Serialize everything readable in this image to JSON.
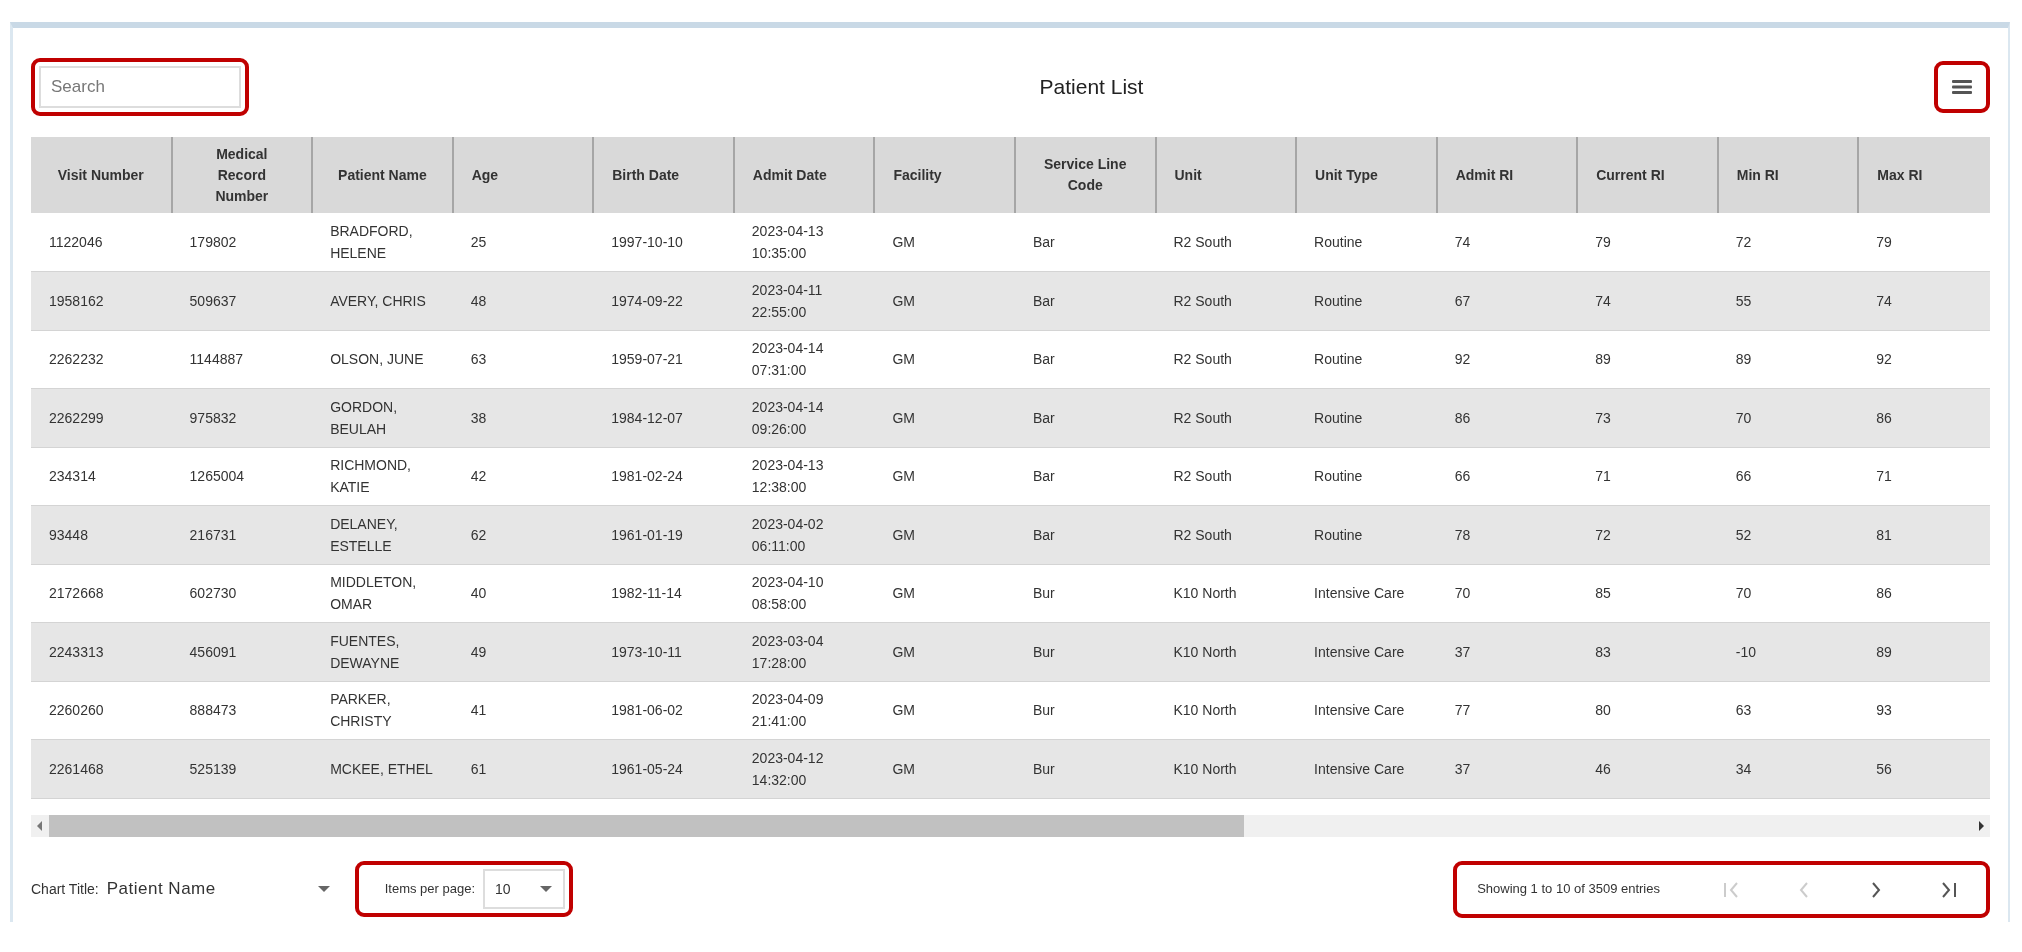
{
  "search": {
    "placeholder": "Search",
    "highlighted": true
  },
  "title": "Patient List",
  "menu": {
    "highlighted": true
  },
  "table": {
    "columns": [
      "Visit Number",
      "Medical Record Number",
      "Patient Name",
      "Age",
      "Birth Date",
      "Admit Date",
      "Facility",
      "Service Line Code",
      "Unit",
      "Unit Type",
      "Admit RI",
      "Current RI",
      "Min RI",
      "Max RI"
    ],
    "rows": [
      [
        "1122046",
        "179802",
        "BRADFORD, HELENE",
        "25",
        "1997-10-10",
        "2023-04-13 10:35:00",
        "GM",
        "Bar",
        "R2 South",
        "Routine",
        "74",
        "79",
        "72",
        "79"
      ],
      [
        "1958162",
        "509637",
        "AVERY, CHRIS",
        "48",
        "1974-09-22",
        "2023-04-11 22:55:00",
        "GM",
        "Bar",
        "R2 South",
        "Routine",
        "67",
        "74",
        "55",
        "74"
      ],
      [
        "2262232",
        "1144887",
        "OLSON, JUNE",
        "63",
        "1959-07-21",
        "2023-04-14 07:31:00",
        "GM",
        "Bar",
        "R2 South",
        "Routine",
        "92",
        "89",
        "89",
        "92"
      ],
      [
        "2262299",
        "975832",
        "GORDON, BEULAH",
        "38",
        "1984-12-07",
        "2023-04-14 09:26:00",
        "GM",
        "Bar",
        "R2 South",
        "Routine",
        "86",
        "73",
        "70",
        "86"
      ],
      [
        "234314",
        "1265004",
        "RICHMOND, KATIE",
        "42",
        "1981-02-24",
        "2023-04-13 12:38:00",
        "GM",
        "Bar",
        "R2 South",
        "Routine",
        "66",
        "71",
        "66",
        "71"
      ],
      [
        "93448",
        "216731",
        "DELANEY, ESTELLE",
        "62",
        "1961-01-19",
        "2023-04-02 06:11:00",
        "GM",
        "Bar",
        "R2 South",
        "Routine",
        "78",
        "72",
        "52",
        "81"
      ],
      [
        "2172668",
        "602730",
        "MIDDLETON, OMAR",
        "40",
        "1982-11-14",
        "2023-04-10 08:58:00",
        "GM",
        "Bur",
        "K10 North",
        "Intensive Care",
        "70",
        "85",
        "70",
        "86"
      ],
      [
        "2243313",
        "456091",
        "FUENTES, DEWAYNE",
        "49",
        "1973-10-11",
        "2023-03-04 17:28:00",
        "GM",
        "Bur",
        "K10 North",
        "Intensive Care",
        "37",
        "83",
        "-10",
        "89"
      ],
      [
        "2260260",
        "888473",
        "PARKER, CHRISTY",
        "41",
        "1981-06-02",
        "2023-04-09 21:41:00",
        "GM",
        "Bur",
        "K10 North",
        "Intensive Care",
        "77",
        "80",
        "63",
        "93"
      ],
      [
        "2261468",
        "525139",
        "MCKEE, ETHEL",
        "61",
        "1961-05-24",
        "2023-04-12 14:32:00",
        "GM",
        "Bur",
        "K10 North",
        "Intensive Care",
        "37",
        "46",
        "34",
        "56"
      ]
    ]
  },
  "chart_title": {
    "label": "Chart Title:",
    "value": "Patient Name"
  },
  "items_per_page": {
    "label": "Items per page:",
    "value": "10",
    "highlighted": true
  },
  "pagination": {
    "summary": "Showing 1 to 10 of 3509 entries",
    "highlighted": true,
    "buttons": [
      {
        "kind": "first",
        "disabled": true
      },
      {
        "kind": "previous",
        "disabled": true
      },
      {
        "kind": "next",
        "disabled": false
      },
      {
        "kind": "last",
        "disabled": false
      }
    ]
  }
}
